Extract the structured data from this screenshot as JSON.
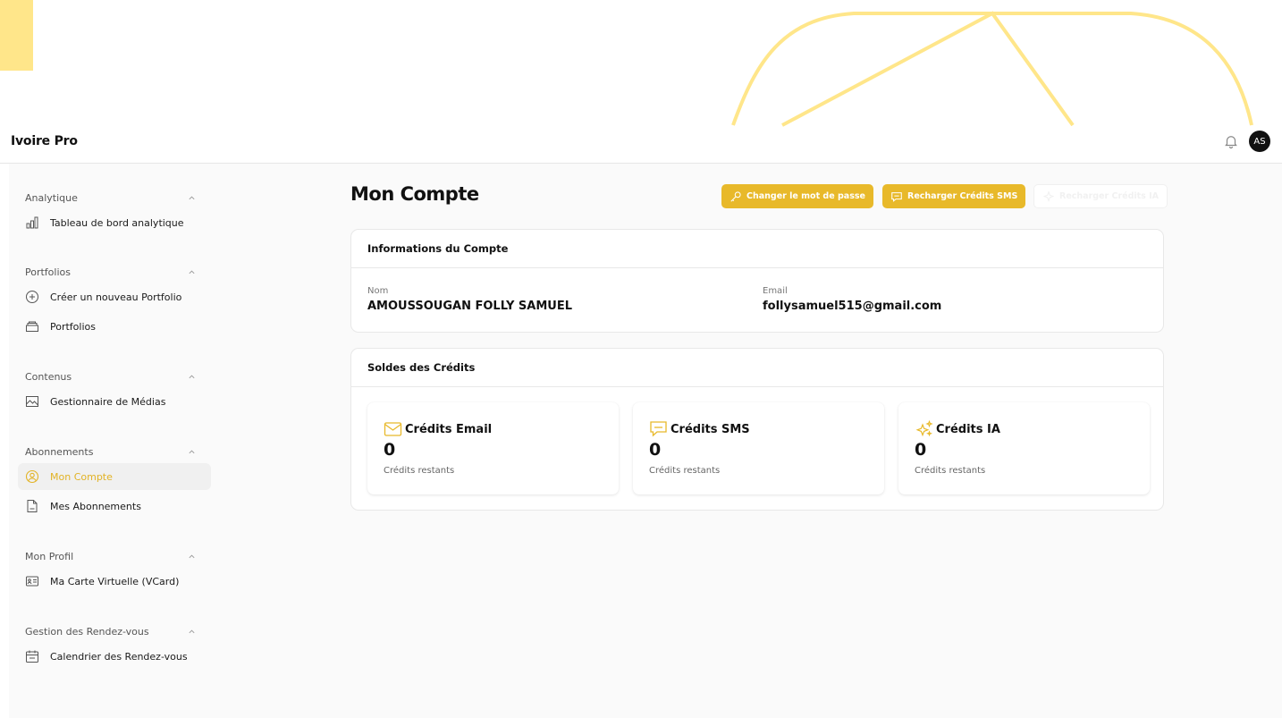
{
  "app": {
    "brand": "Ivoire Pro",
    "avatar_initials": "AS"
  },
  "colors": {
    "accent": "#e8b92a",
    "active_text": "#e2b325",
    "deco": "#ffe68a"
  },
  "sidebar": {
    "sections": [
      {
        "title": "Analytique",
        "items": [
          {
            "label": "Tableau de bord analytique",
            "icon": "bar-chart-icon"
          }
        ]
      },
      {
        "title": "Portfolios",
        "items": [
          {
            "label": "Créer un nouveau Portfolio",
            "icon": "plus-circle-icon"
          },
          {
            "label": "Portfolios",
            "icon": "folder-icon"
          }
        ]
      },
      {
        "title": "Contenus",
        "items": [
          {
            "label": "Gestionnaire de Médias",
            "icon": "image-icon"
          }
        ]
      },
      {
        "title": "Abonnements",
        "items": [
          {
            "label": "Mon Compte",
            "icon": "user-circle-icon",
            "active": true
          },
          {
            "label": "Mes Abonnements",
            "icon": "document-icon"
          }
        ]
      },
      {
        "title": "Mon Profil",
        "items": [
          {
            "label": "Ma Carte Virtuelle (VCard)",
            "icon": "id-card-icon"
          }
        ]
      },
      {
        "title": "Gestion des Rendez-vous",
        "items": [
          {
            "label": "Calendrier des Rendez-vous",
            "icon": "calendar-icon"
          }
        ]
      }
    ]
  },
  "main": {
    "title": "Mon Compte",
    "buttons": {
      "change_password": "Changer le mot de passe",
      "recharge_sms": "Recharger Crédits SMS",
      "recharge_ia": "Recharger Crédits IA"
    },
    "account": {
      "header": "Informations du Compte",
      "name_label": "Nom",
      "name_value": "AMOUSSOUGAN FOLLY SAMUEL",
      "email_label": "Email",
      "email_value": "follysamuel515@gmail.com"
    },
    "credits": {
      "header": "Soldes des Crédits",
      "items": [
        {
          "title": "Crédits Email",
          "value": "0",
          "sub": "Crédits restants",
          "icon": "mail-icon"
        },
        {
          "title": "Crédits SMS",
          "value": "0",
          "sub": "Crédits restants",
          "icon": "chat-icon"
        },
        {
          "title": "Crédits IA",
          "value": "0",
          "sub": "Crédits restants",
          "icon": "sparkles-icon"
        }
      ]
    }
  }
}
